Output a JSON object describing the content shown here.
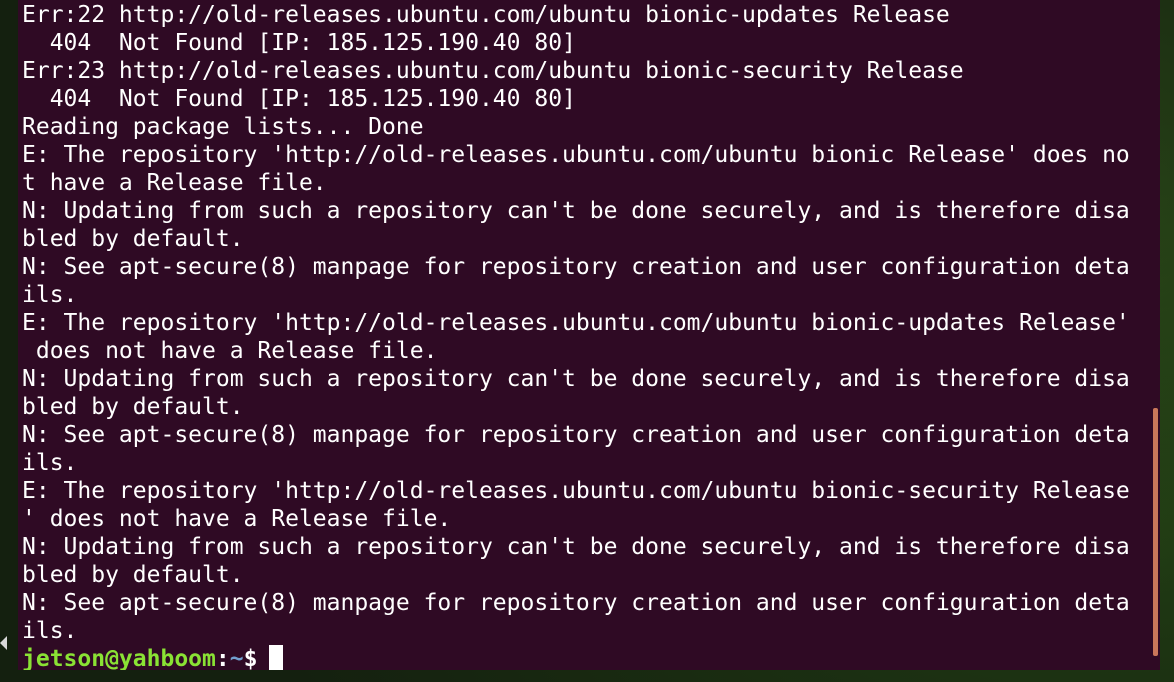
{
  "terminal": {
    "lines": [
      "Err:22 http://old-releases.ubuntu.com/ubuntu bionic-updates Release",
      "  404  Not Found [IP: 185.125.190.40 80]",
      "Err:23 http://old-releases.ubuntu.com/ubuntu bionic-security Release",
      "  404  Not Found [IP: 185.125.190.40 80]",
      "Reading package lists... Done",
      "E: The repository 'http://old-releases.ubuntu.com/ubuntu bionic Release' does no",
      "t have a Release file.",
      "N: Updating from such a repository can't be done securely, and is therefore disa",
      "bled by default.",
      "N: See apt-secure(8) manpage for repository creation and user configuration deta",
      "ils.",
      "E: The repository 'http://old-releases.ubuntu.com/ubuntu bionic-updates Release'",
      " does not have a Release file.",
      "N: Updating from such a repository can't be done securely, and is therefore disa",
      "bled by default.",
      "N: See apt-secure(8) manpage for repository creation and user configuration deta",
      "ils.",
      "E: The repository 'http://old-releases.ubuntu.com/ubuntu bionic-security Release",
      "' does not have a Release file.",
      "N: Updating from such a repository can't be done securely, and is therefore disa",
      "bled by default.",
      "N: See apt-secure(8) manpage for repository creation and user configuration deta",
      "ils."
    ],
    "prompt": {
      "user_host": "jetson@yahboom",
      "colon": ":",
      "path": "~",
      "symbol": "$"
    },
    "colors": {
      "background": "#2f0a24",
      "text": "#ffffff",
      "prompt_user": "#8ae234",
      "prompt_path": "#729fcf",
      "scrollbar": "#c9775a"
    }
  }
}
